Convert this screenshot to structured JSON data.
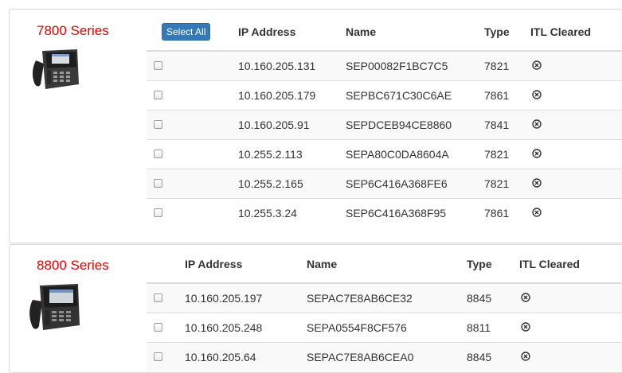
{
  "series": [
    {
      "title": "7800 Series",
      "select_all_label": "Select All",
      "headers": {
        "ip": "IP Address",
        "name": "Name",
        "type": "Type",
        "itl": "ITL Cleared"
      },
      "rows": [
        {
          "ip": "10.160.205.131",
          "name": "SEP00082F1BC7C5",
          "type": "7821"
        },
        {
          "ip": "10.160.205.179",
          "name": "SEPBC671C30C6AE",
          "type": "7861"
        },
        {
          "ip": "10.160.205.91",
          "name": "SEPDCEB94CE8860",
          "type": "7841"
        },
        {
          "ip": "10.255.2.113",
          "name": "SEPA80C0DA8604A",
          "type": "7821"
        },
        {
          "ip": "10.255.2.165",
          "name": "SEP6C416A368FE6",
          "type": "7821"
        },
        {
          "ip": "10.255.3.24",
          "name": "SEP6C416A368F95",
          "type": "7861"
        }
      ]
    },
    {
      "title": "8800 Series",
      "headers": {
        "ip": "IP Address",
        "name": "Name",
        "type": "Type",
        "itl": "ITL Cleared"
      },
      "rows": [
        {
          "ip": "10.160.205.197",
          "name": "SEPAC7E8AB6CE32",
          "type": "8845"
        },
        {
          "ip": "10.160.205.248",
          "name": "SEPA0554F8CF576",
          "type": "8811"
        },
        {
          "ip": "10.160.205.64",
          "name": "SEPAC7E8AB6CEA0",
          "type": "8845"
        }
      ]
    }
  ],
  "colors": {
    "series_title": "#e30000",
    "button": "#337ab7"
  },
  "itl_status_icon": "circle-x-icon"
}
